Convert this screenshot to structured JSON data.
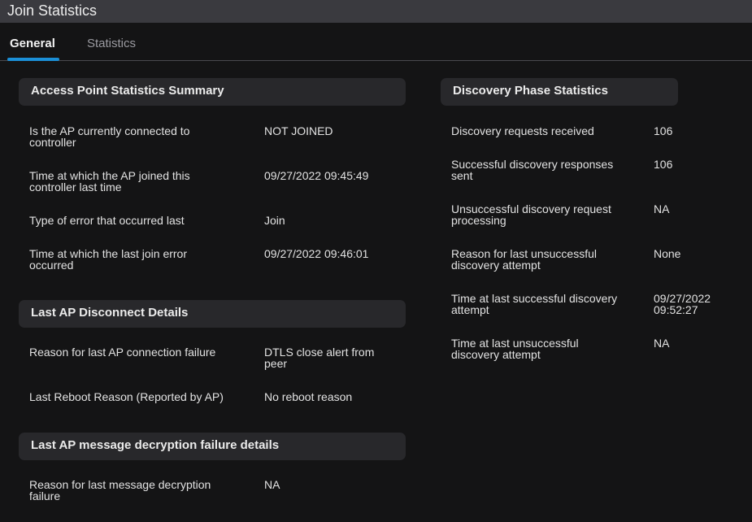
{
  "title": "Join Statistics",
  "tabs": [
    {
      "label": "General"
    },
    {
      "label": "Statistics"
    }
  ],
  "ap_summary": {
    "header": "Access Point Statistics Summary",
    "rows": [
      {
        "label": "Is the AP currently connected to controller",
        "value": "NOT JOINED"
      },
      {
        "label": "Time at which the AP joined this controller last time",
        "value": "09/27/2022 09:45:49"
      },
      {
        "label": "Type of error that occurred last",
        "value": "Join"
      },
      {
        "label": "Time at which the last join error occurred",
        "value": "09/27/2022 09:46:01"
      }
    ]
  },
  "disconnect": {
    "header": "Last AP Disconnect Details",
    "rows": [
      {
        "label": "Reason for last AP connection failure",
        "value": "DTLS close alert from peer"
      },
      {
        "label": "Last Reboot Reason (Reported by AP)",
        "value": "No reboot reason"
      }
    ]
  },
  "decryption": {
    "header": "Last AP message decryption failure details",
    "rows": [
      {
        "label": "Reason for last message decryption failure",
        "value": "NA"
      }
    ]
  },
  "discovery": {
    "header": "Discovery Phase Statistics",
    "rows": [
      {
        "label": "Discovery requests received",
        "value": "106"
      },
      {
        "label": "Successful discovery responses sent",
        "value": "106"
      },
      {
        "label": "Unsuccessful discovery request processing",
        "value": "NA"
      },
      {
        "label": "Reason for last unsuccessful discovery attempt",
        "value": "None"
      },
      {
        "label": "Time at last successful discovery attempt",
        "value": "09/27/2022 09:52:27"
      },
      {
        "label": "Time at last unsuccessful discovery attempt",
        "value": "NA"
      }
    ]
  }
}
